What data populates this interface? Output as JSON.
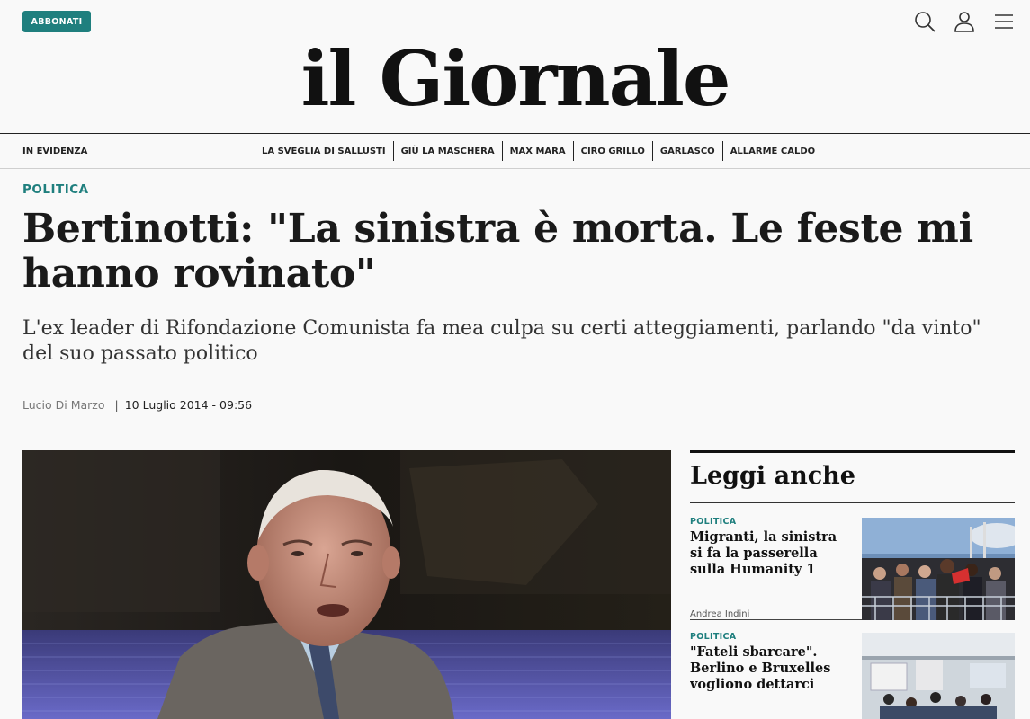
{
  "header": {
    "subscribe_label": "ABBONATI",
    "logo_text": "il Giornale",
    "icons": [
      "search-icon",
      "user-icon",
      "menu-icon"
    ]
  },
  "nav": {
    "label": "IN EVIDENZA",
    "links": [
      "LA SVEGLIA DI SALLUSTI",
      "GIÙ LA MASCHERA",
      "MAX MARA",
      "CIRO GRILLO",
      "GARLASCO",
      "ALLARME CALDO"
    ]
  },
  "article": {
    "section": "POLITICA",
    "title": "Bertinotti: \"La sinistra è morta. Le feste mi hanno rovinato\"",
    "subtitle": "L'ex leader di Rifondazione Comunista fa mea culpa su certi atteggiamenti, parlando \"da vinto\" del suo passato politico",
    "author": "Lucio Di Marzo",
    "separator": "|",
    "date": "10 Luglio 2014 - 09:56"
  },
  "sidebar": {
    "title": "Leggi anche",
    "items": [
      {
        "category": "POLITICA",
        "title": "Migranti, la sinistra si fa la passerella sulla Humanity 1 per…",
        "author": "Andrea Indini"
      },
      {
        "category": "POLITICA",
        "title": "\"Fateli sbarcare\". Berlino e Bruxelles vogliono dettarci la…",
        "author": ""
      }
    ]
  },
  "colors": {
    "accent": "#1f7f7e",
    "text": "#1a1a1a",
    "background": "#f9f9f9"
  }
}
